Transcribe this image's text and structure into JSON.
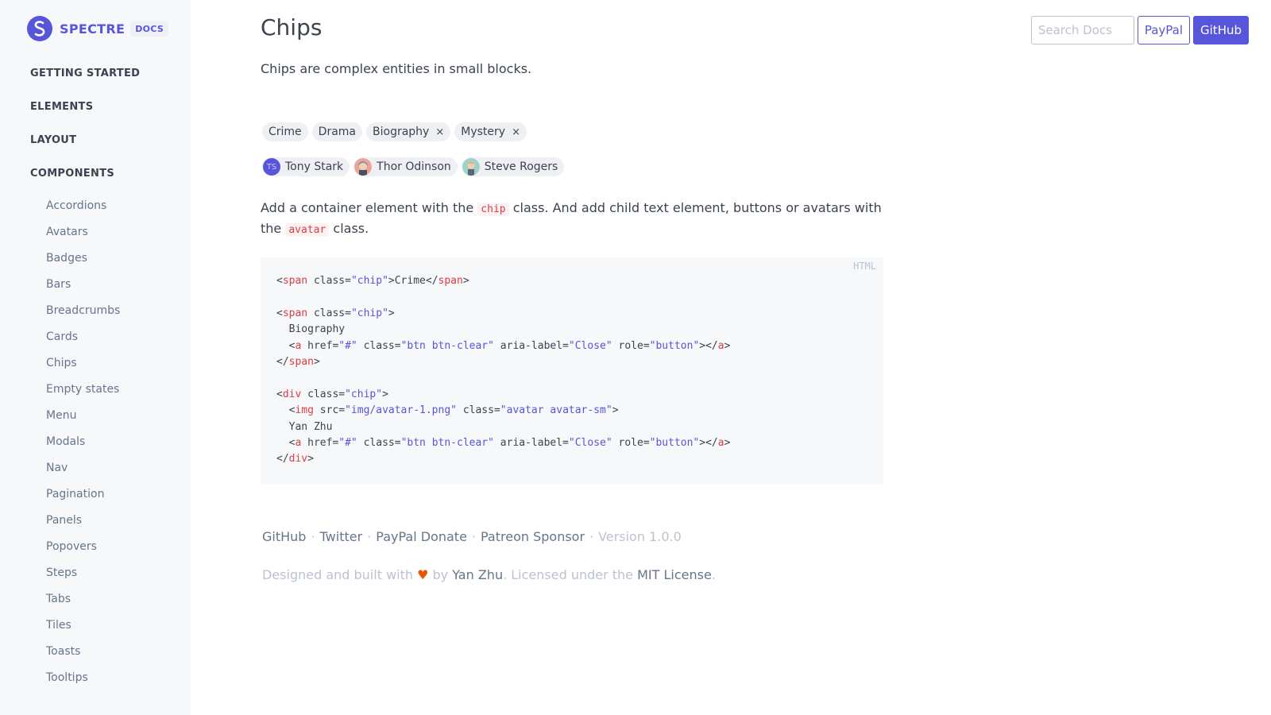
{
  "brand": {
    "name": "SPECTRE",
    "label": "DOCS",
    "accent": "#5755d9"
  },
  "sidebar": {
    "sections": [
      {
        "label": "GETTING STARTED"
      },
      {
        "label": "ELEMENTS"
      },
      {
        "label": "LAYOUT"
      },
      {
        "label": "COMPONENTS"
      }
    ],
    "items": [
      {
        "label": "Accordions"
      },
      {
        "label": "Avatars"
      },
      {
        "label": "Badges"
      },
      {
        "label": "Bars"
      },
      {
        "label": "Breadcrumbs"
      },
      {
        "label": "Cards"
      },
      {
        "label": "Chips"
      },
      {
        "label": "Empty states"
      },
      {
        "label": "Menu"
      },
      {
        "label": "Modals"
      },
      {
        "label": "Nav"
      },
      {
        "label": "Pagination"
      },
      {
        "label": "Panels"
      },
      {
        "label": "Popovers"
      },
      {
        "label": "Steps"
      },
      {
        "label": "Tabs"
      },
      {
        "label": "Tiles"
      },
      {
        "label": "Toasts"
      },
      {
        "label": "Tooltips"
      }
    ]
  },
  "topbar": {
    "search_placeholder": "Search Docs",
    "paypal_label": "PayPal",
    "github_label": "GitHub"
  },
  "page": {
    "title": "Chips",
    "lead": "Chips are complex entities in small blocks."
  },
  "chips": {
    "tags": [
      {
        "label": "Crime"
      },
      {
        "label": "Drama"
      },
      {
        "label": "Biography",
        "close": "×"
      },
      {
        "label": "Mystery",
        "close": "×"
      }
    ],
    "people": [
      {
        "label": "Tony Stark",
        "initials": "TS"
      },
      {
        "label": "Thor Odinson"
      },
      {
        "label": "Steve Rogers"
      }
    ]
  },
  "description": {
    "part1": "Add a container element with the ",
    "code1": "chip",
    "part2": " class. And add child text element, buttons or avatars with the ",
    "code2": "avatar",
    "part3": " class."
  },
  "code": {
    "lang": "HTML",
    "lines": [
      [
        [
          "p",
          "<"
        ],
        [
          "tag",
          "span"
        ],
        [
          "attr",
          " class="
        ],
        [
          "val",
          "\"chip\""
        ],
        [
          "p",
          ">"
        ],
        [
          "text",
          "Crime"
        ],
        [
          "p",
          "</"
        ],
        [
          "tag",
          "span"
        ],
        [
          "p",
          ">"
        ]
      ],
      [],
      [
        [
          "p",
          "<"
        ],
        [
          "tag",
          "span"
        ],
        [
          "attr",
          " class="
        ],
        [
          "val",
          "\"chip\""
        ],
        [
          "p",
          ">"
        ]
      ],
      [
        [
          "text",
          "  Biography"
        ]
      ],
      [
        [
          "p",
          "  <"
        ],
        [
          "tag",
          "a"
        ],
        [
          "attr",
          " href="
        ],
        [
          "val",
          "\"#\""
        ],
        [
          "attr",
          " class="
        ],
        [
          "val",
          "\"btn btn-clear\""
        ],
        [
          "attr",
          " aria-label="
        ],
        [
          "val",
          "\"Close\""
        ],
        [
          "attr",
          " role="
        ],
        [
          "val",
          "\"button\""
        ],
        [
          "p",
          "></"
        ],
        [
          "tag",
          "a"
        ],
        [
          "p",
          ">"
        ]
      ],
      [
        [
          "p",
          "</"
        ],
        [
          "tag",
          "span"
        ],
        [
          "p",
          ">"
        ]
      ],
      [],
      [
        [
          "p",
          "<"
        ],
        [
          "tag",
          "div"
        ],
        [
          "attr",
          " class="
        ],
        [
          "val",
          "\"chip\""
        ],
        [
          "p",
          ">"
        ]
      ],
      [
        [
          "p",
          "  <"
        ],
        [
          "tag",
          "img"
        ],
        [
          "attr",
          " src="
        ],
        [
          "val",
          "\"img/avatar-1.png\""
        ],
        [
          "attr",
          " class="
        ],
        [
          "val",
          "\"avatar avatar-sm\""
        ],
        [
          "p",
          ">"
        ]
      ],
      [
        [
          "text",
          "  Yan Zhu"
        ]
      ],
      [
        [
          "p",
          "  <"
        ],
        [
          "tag",
          "a"
        ],
        [
          "attr",
          " href="
        ],
        [
          "val",
          "\"#\""
        ],
        [
          "attr",
          " class="
        ],
        [
          "val",
          "\"btn btn-clear\""
        ],
        [
          "attr",
          " aria-label="
        ],
        [
          "val",
          "\"Close\""
        ],
        [
          "attr",
          " role="
        ],
        [
          "val",
          "\"button\""
        ],
        [
          "p",
          "></"
        ],
        [
          "tag",
          "a"
        ],
        [
          "p",
          ">"
        ]
      ],
      [
        [
          "p",
          "</"
        ],
        [
          "tag",
          "div"
        ],
        [
          "p",
          ">"
        ]
      ]
    ]
  },
  "footer": {
    "links": [
      {
        "label": "GitHub"
      },
      {
        "label": "Twitter"
      },
      {
        "label": "PayPal Donate"
      },
      {
        "label": "Patreon Sponsor"
      }
    ],
    "separator": "·",
    "version": "Version 1.0.0",
    "credit": {
      "prefix": "Designed and built with ",
      "heart": "♥",
      "by": " by ",
      "author": "Yan Zhu",
      "middle": ". Licensed under the ",
      "license": "MIT License",
      "suffix": "."
    }
  }
}
